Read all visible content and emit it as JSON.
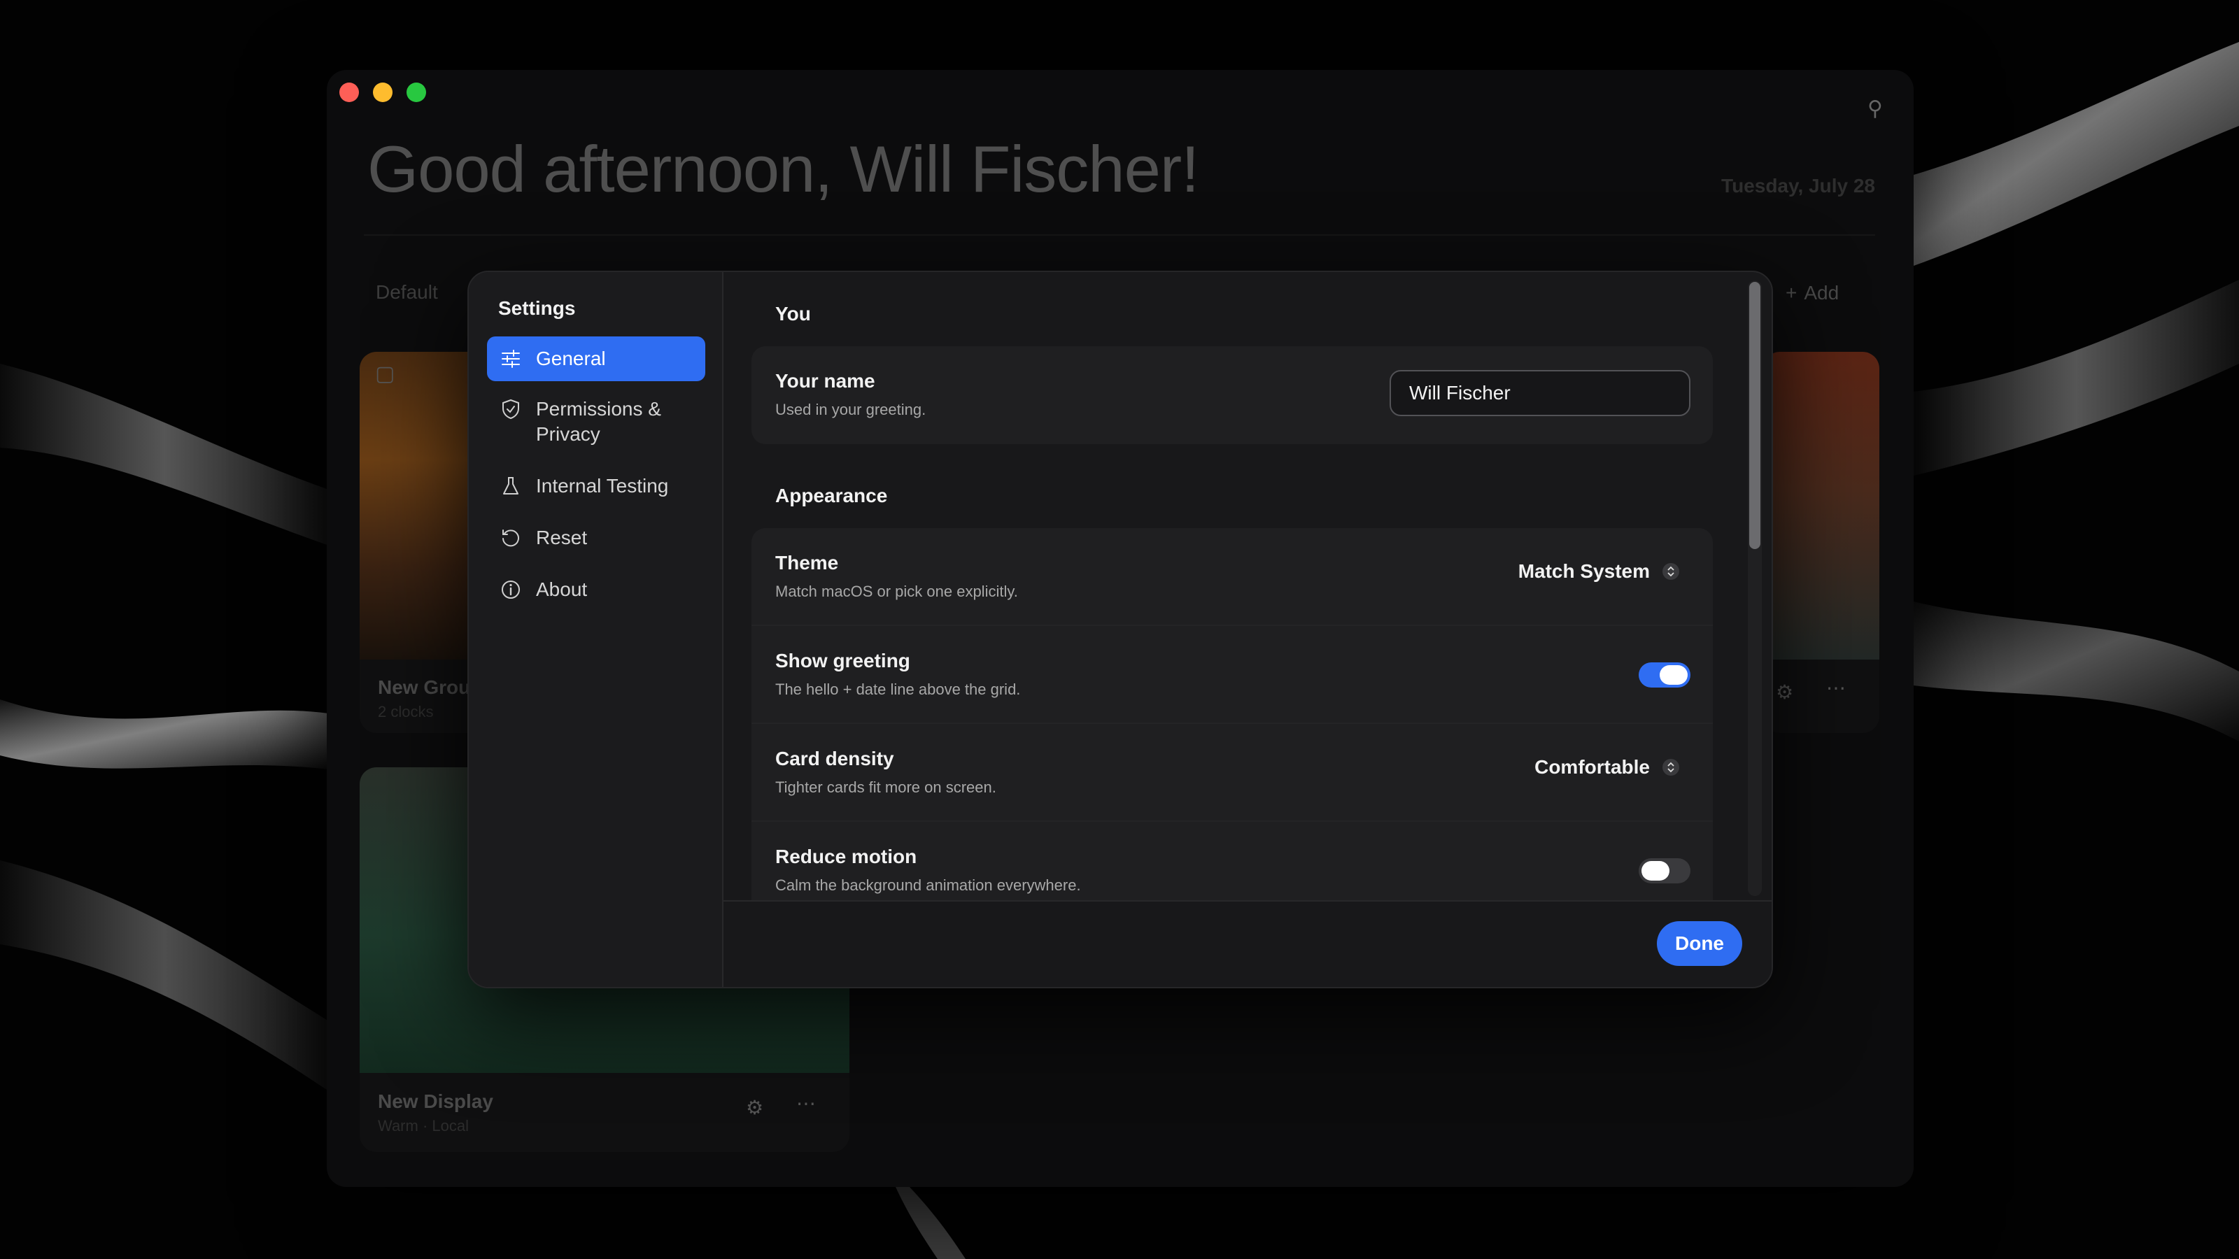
{
  "app": {
    "greeting": "Good afternoon, Will Fischer!",
    "date": "Tuesday, July 28",
    "tab_default": "Default",
    "add_label": "Add",
    "cards": [
      {
        "title": "New Grou",
        "subtitle": "2 clocks"
      },
      {
        "title": "New Display",
        "subtitle": "Warm · Local"
      }
    ]
  },
  "settings": {
    "title": "Settings",
    "nav": [
      {
        "label": "General",
        "icon": "sliders-icon",
        "active": true
      },
      {
        "label": "Permissions & Privacy",
        "icon": "shield-icon"
      },
      {
        "label": "Internal Testing",
        "icon": "flask-icon"
      },
      {
        "label": "Reset",
        "icon": "reset-icon"
      },
      {
        "label": "About",
        "icon": "info-icon"
      }
    ],
    "sections": {
      "you": {
        "heading": "You",
        "name_title": "Your name",
        "name_sub": "Used in your greeting.",
        "name_value": "Will Fischer"
      },
      "appearance": {
        "heading": "Appearance",
        "rows": [
          {
            "title": "Theme",
            "subtitle": "Match macOS or pick one explicitly.",
            "control": "select",
            "value": "Match System"
          },
          {
            "title": "Show greeting",
            "subtitle": "The hello + date line above the grid.",
            "control": "toggle",
            "on": true
          },
          {
            "title": "Card density",
            "subtitle": "Tighter cards fit more on screen.",
            "control": "select",
            "value": "Comfortable"
          },
          {
            "title": "Reduce motion",
            "subtitle": "Calm the background animation everywhere.",
            "control": "toggle",
            "on": false
          }
        ]
      }
    },
    "done_label": "Done"
  },
  "colors": {
    "accent": "#2f6df2",
    "modal_bg": "#18181a",
    "window_bg": "#0c0c0d"
  }
}
